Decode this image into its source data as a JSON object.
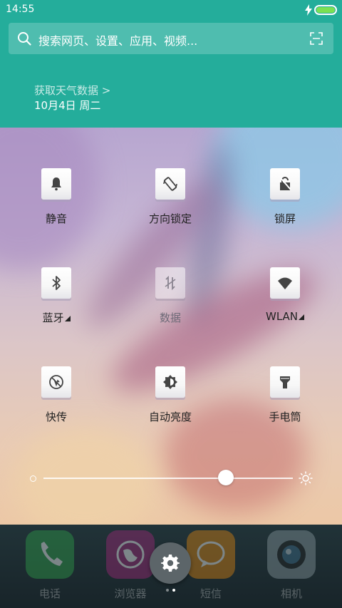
{
  "status_bar": {
    "time": "14:55",
    "battery_color": "#7be053"
  },
  "search": {
    "placeholder": "搜索网页、设置、应用、视频..."
  },
  "weather": {
    "link_text": "获取天气数据 >",
    "date": "10月4日 周二"
  },
  "colors": {
    "header": "#24ad9b",
    "dock": "#1b2a30"
  },
  "toggles": [
    {
      "label": "静音",
      "icon": "bell-icon",
      "state": "on"
    },
    {
      "label": "方向锁定",
      "icon": "rotation-lock-icon",
      "state": "on"
    },
    {
      "label": "锁屏",
      "icon": "lock-screen-icon",
      "state": "on"
    },
    {
      "label": "蓝牙",
      "icon": "bluetooth-icon",
      "state": "on",
      "has_more": true
    },
    {
      "label": "数据",
      "icon": "mobile-data-icon",
      "state": "off"
    },
    {
      "label": "WLAN",
      "icon": "wifi-icon",
      "state": "on",
      "has_more": true
    },
    {
      "label": "快传",
      "icon": "quick-transfer-icon",
      "state": "on"
    },
    {
      "label": "自动亮度",
      "icon": "auto-brightness-icon",
      "state": "on"
    },
    {
      "label": "手电筒",
      "icon": "flashlight-icon",
      "state": "on"
    }
  ],
  "brightness": {
    "level_percent": 73
  },
  "dock": {
    "apps": [
      {
        "label": "电话",
        "icon": "phone-icon"
      },
      {
        "label": "浏览器",
        "icon": "browser-icon"
      },
      {
        "label": "短信",
        "icon": "messages-icon"
      },
      {
        "label": "相机",
        "icon": "camera-icon"
      }
    ],
    "settings_icon": "gear-icon",
    "page_count": 2,
    "current_page": 2
  }
}
